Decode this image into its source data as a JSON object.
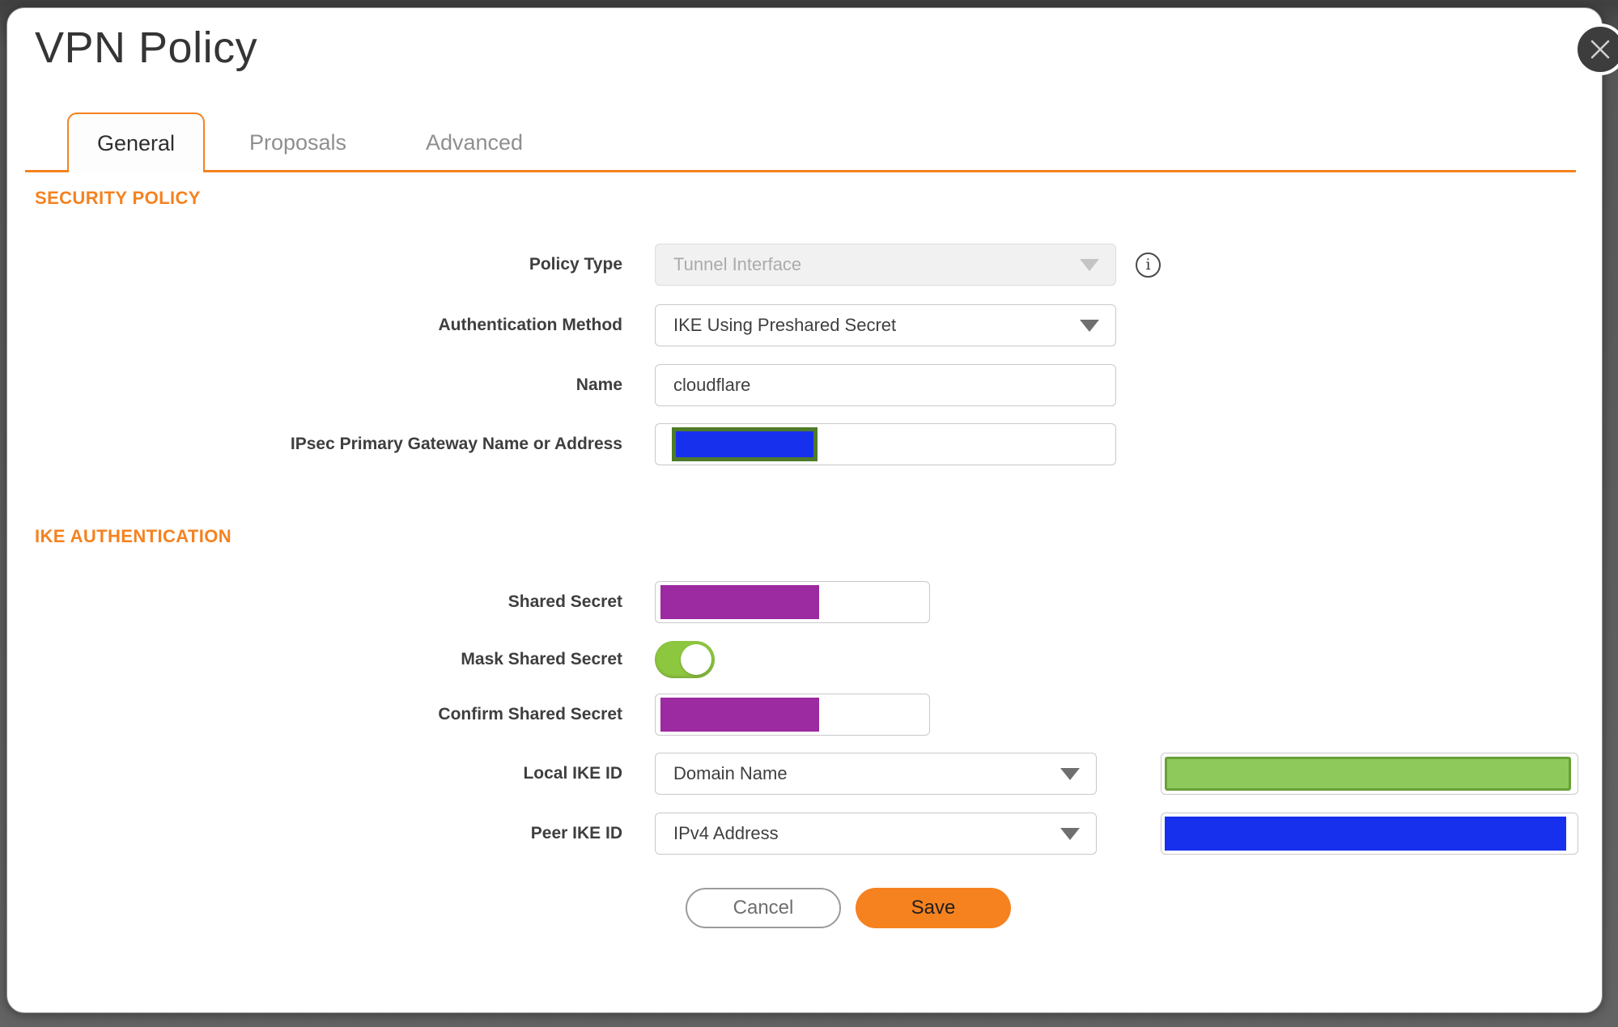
{
  "window": {
    "title": "VPN Policy"
  },
  "tabs": [
    {
      "label": "General",
      "active": true
    },
    {
      "label": "Proposals",
      "active": false
    },
    {
      "label": "Advanced",
      "active": false
    }
  ],
  "sections": [
    {
      "title": "SECURITY POLICY"
    },
    {
      "title": "IKE AUTHENTICATION"
    }
  ],
  "form": {
    "policy_type": {
      "label": "Policy Type",
      "value": "Tunnel Interface",
      "disabled": true
    },
    "authentication_method": {
      "label": "Authentication Method",
      "value": "IKE Using Preshared Secret"
    },
    "name": {
      "label": "Name",
      "value": "cloudflare"
    },
    "ipsec_gateway": {
      "label": "IPsec Primary Gateway Name or Address",
      "value": "",
      "redacted": true
    },
    "shared_secret": {
      "label": "Shared Secret",
      "value": "",
      "redacted": true
    },
    "mask_shared_secret": {
      "label": "Mask Shared Secret",
      "enabled": true
    },
    "confirm_shared_secret": {
      "label": "Confirm Shared Secret",
      "value": "",
      "redacted": true
    },
    "local_ike_id": {
      "label": "Local IKE ID",
      "type_value": "Domain Name",
      "id_value": "",
      "id_redacted": true
    },
    "peer_ike_id": {
      "label": "Peer IKE ID",
      "type_value": "IPv4 Address",
      "id_value": "",
      "id_redacted": true
    }
  },
  "buttons": {
    "cancel": "Cancel",
    "save": "Save"
  },
  "icons": {
    "info": "i"
  },
  "colors": {
    "accent_orange": "#f5821f",
    "save_button_orange": "#f6821f",
    "toggle_green": "#8dc63f",
    "secret_redaction_purple": "#9c2aa0",
    "gateway_redaction_blue": "#1730ee",
    "gateway_redaction_border_green": "#4e7a29",
    "local_ike_redaction_green": "#8dc95b",
    "local_ike_redaction_border_green": "#69a038",
    "peer_ike_redaction_blue": "#1730ee",
    "disabled_field_bg": "#f1f1f1",
    "close_button_bg": "#3d3d3d"
  }
}
